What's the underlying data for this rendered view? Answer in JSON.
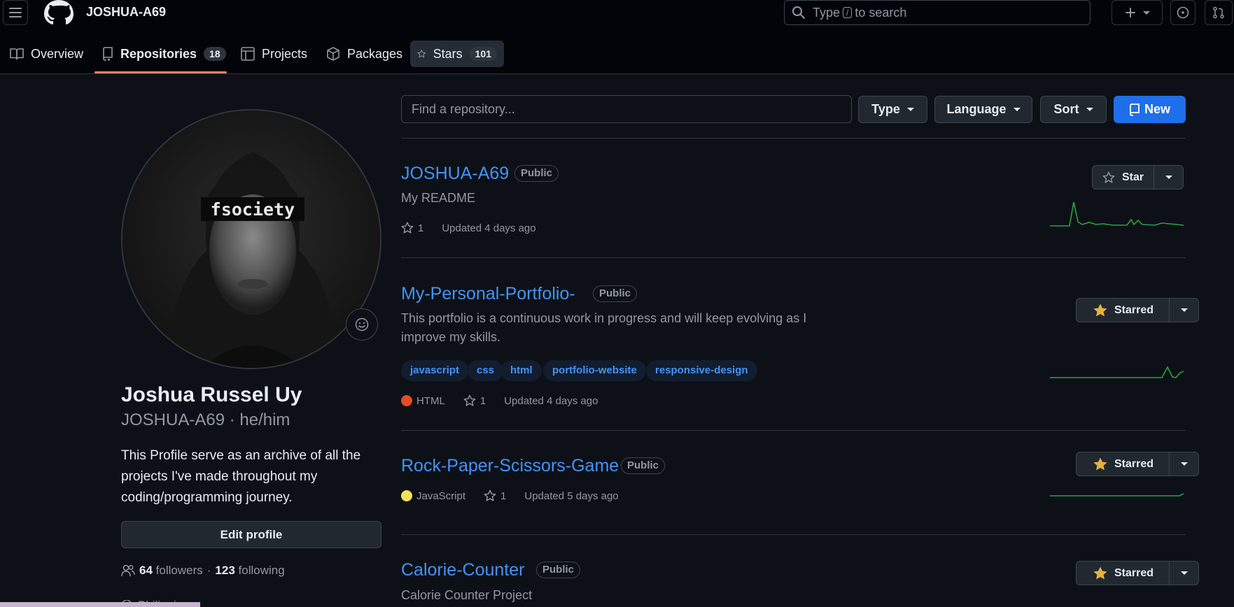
{
  "header": {
    "owner": "JOSHUA-A69",
    "search_prefix": "Type",
    "search_key": "/",
    "search_suffix": "to search"
  },
  "tabs": [
    {
      "label": "Overview"
    },
    {
      "label": "Repositories",
      "count": "18"
    },
    {
      "label": "Projects"
    },
    {
      "label": "Packages"
    },
    {
      "label": "Stars",
      "count": "101"
    }
  ],
  "profile": {
    "avatar_text": "fsociety",
    "full_name": "Joshua Russel Uy",
    "username_line": "JOSHUA-A69 · he/him",
    "bio": "This Profile serve as an archive of all the projects I've made throughout my coding/programming journey.",
    "edit_label": "Edit profile",
    "followers_count": "64",
    "followers_label": "followers",
    "separator": "·",
    "following_count": "123",
    "following_label": "following",
    "location": "Philippines"
  },
  "filters": {
    "search_placeholder": "Find a repository...",
    "type_label": "Type",
    "language_label": "Language",
    "sort_label": "Sort",
    "new_label": "New"
  },
  "repos": [
    {
      "name": "JOSHUA-A69",
      "visibility": "Public",
      "description": "My README",
      "stars": "1",
      "updated": "Updated 4 days ago",
      "star_button": "Star"
    },
    {
      "name": "My-Personal-Portfolio-",
      "visibility": "Public",
      "description_line1": "This portfolio is a continuous work in progress and will keep evolving as I",
      "description_line2": "improve my skills.",
      "topics": [
        "javascript",
        "css",
        "html",
        "portfolio-website",
        "responsive-design"
      ],
      "language": "HTML",
      "language_color": "#e34c26",
      "stars": "1",
      "updated": "Updated 4 days ago",
      "star_button": "Starred"
    },
    {
      "name": "Rock-Paper-Scissors-Game",
      "visibility": "Public",
      "language": "JavaScript",
      "language_color": "#f1e05a",
      "stars": "1",
      "updated": "Updated 5 days ago",
      "star_button": "Starred"
    },
    {
      "name": "Calorie-Counter",
      "visibility": "Public",
      "description": "Calorie Counter Project",
      "star_button": "Starred"
    }
  ],
  "colors": {
    "accent": "#4493f8",
    "primary_button": "#1f6feb",
    "tab_underline": "#f78166",
    "sparkline": "#2ea043",
    "starred_icon": "#e3b341"
  }
}
